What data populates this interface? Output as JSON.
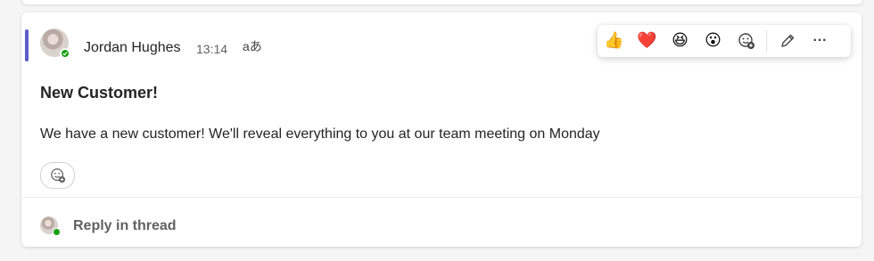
{
  "message": {
    "sender": "Jordan Hughes",
    "time": "13:14",
    "translate_glyph": "aあ",
    "title": "New Customer!",
    "body": "We have a new customer! We'll reveal everything to you at our team meeting on Monday"
  },
  "toolbar": {
    "reactions": [
      {
        "icon": "thumbs-up-icon",
        "glyph": "👍"
      },
      {
        "icon": "heart-icon",
        "glyph": "❤️"
      },
      {
        "icon": "laugh-icon",
        "glyph": "😆"
      },
      {
        "icon": "surprised-icon",
        "glyph": "😮"
      }
    ],
    "add_reaction_icon": "emoji-add-icon",
    "edit_icon": "pencil-icon",
    "more_icon": "more-icon",
    "more_glyph": "···"
  },
  "footer": {
    "reply_label": "Reply in thread"
  },
  "colors": {
    "accent": "#5b5fc7",
    "presence": "#13a10e"
  }
}
